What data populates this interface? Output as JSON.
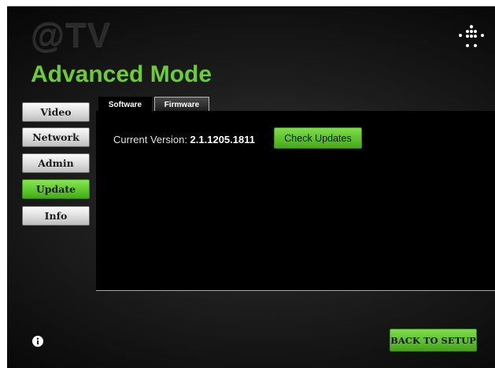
{
  "brand": {
    "logo_text": "@TV"
  },
  "header": {
    "title": "Advanced Mode"
  },
  "sidebar": {
    "items": [
      {
        "label": "Video",
        "active": false
      },
      {
        "label": "Network",
        "active": false
      },
      {
        "label": "Admin",
        "active": false
      },
      {
        "label": "Update",
        "active": true
      },
      {
        "label": "Info",
        "active": false
      }
    ]
  },
  "tabs": [
    {
      "label": "Software",
      "selected": true
    },
    {
      "label": "Firmware",
      "selected": false
    }
  ],
  "software": {
    "version_label": "Current Version: ",
    "version_value": "2.1.1205.1811",
    "check_updates_label": "Check Updates"
  },
  "footer": {
    "back_label": "BACK TO SETUP"
  },
  "icons": {
    "menu": "dots-grid-icon",
    "info": "info-icon"
  },
  "colors": {
    "accent": "#5bc02c",
    "title": "#6ccc35",
    "background": "#0a0a0a"
  }
}
